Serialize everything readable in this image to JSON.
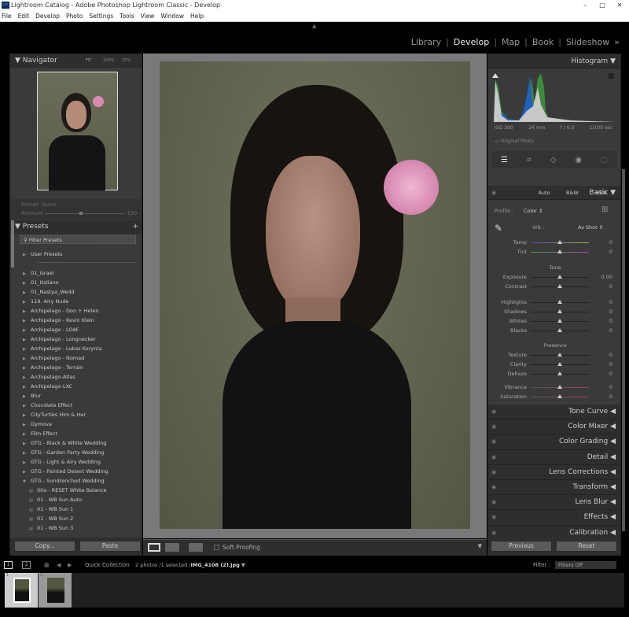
{
  "window": {
    "title": "Lightroom Catalog - Adobe Photoshop Lightroom Classic - Develop",
    "icon": "Lrc",
    "controls": [
      "–",
      "□",
      "✕"
    ]
  },
  "menu": [
    "File",
    "Edit",
    "Develop",
    "Photo",
    "Settings",
    "Tools",
    "View",
    "Window",
    "Help"
  ],
  "modules": [
    {
      "label": "Library",
      "active": false
    },
    {
      "label": "Develop",
      "active": true
    },
    {
      "label": "Map",
      "active": false
    },
    {
      "label": "Book",
      "active": false
    },
    {
      "label": "Slideshow",
      "active": false
    }
  ],
  "modules_more": "»",
  "navigator": {
    "title": "Navigator",
    "zoom_options": [
      "FIT",
      "100%",
      "25%"
    ]
  },
  "preset_amount": {
    "preset_label": "Preset",
    "preset_value": "None",
    "amount_label": "Amount",
    "amount_value": "100",
    "amount_fraction": 0.6
  },
  "presets": {
    "title": "Presets",
    "add": "+",
    "filter_placeholder": "Filter Presets",
    "user_presets": "User Presets",
    "items": [
      "01_Israel",
      "01_Italiano",
      "01_Nastya_Wedd",
      "119. Airy Nude",
      "Archipelago - Don + Helen",
      "Archipelago - Kevin Klein",
      "Archipelago - LOAF",
      "Archipelago - Longnecker",
      "Archipelago - Lukas Korynta",
      "Archipelago - Nomad",
      "Archipelago - Terrain",
      "Archipelago-Atlas",
      "Archipelago-LXC",
      "Blur",
      "Chocolate Effect",
      "CityTurtles Him & Her",
      "Dymova",
      "Film Effect",
      "GTG - Black & White Wedding",
      "GTG - Garden Party Wedding",
      "GTG - Light & Airy Wedding",
      "GTG - Painted Desert Wedding"
    ],
    "expanded": "GTG - Sundrenched Wedding",
    "children": [
      "00a - RESET White Balance",
      "01 - WB Sun  Auto",
      "01 - WB Sun 1",
      "01 - WB Sun 2",
      "01 - WB Sun 3"
    ]
  },
  "left_buttons": {
    "copy": "Copy...",
    "paste": "Paste"
  },
  "toolbar": {
    "soft_proofing": "Soft Proofing"
  },
  "histogram": {
    "title": "Histogram",
    "iso": "ISO 200",
    "focal": "24 mm",
    "aperture": "f / 6.3",
    "shutter": "1/100 sec",
    "original_photo": "Original Photo"
  },
  "basic": {
    "title": "Basic",
    "auto": "Auto",
    "bw": "B&W",
    "hdr": "HDR",
    "profile_label": "Profile :",
    "profile_value": "Color",
    "wb_label": "WB :",
    "wb_value": "As Shot",
    "tone_label": "Tone",
    "presence_label": "Presence",
    "sliders": [
      {
        "label": "Temp",
        "value": "0"
      },
      {
        "label": "Tint",
        "value": "0"
      },
      {
        "label": "Exposure",
        "value": "0.00"
      },
      {
        "label": "Contrast",
        "value": "0"
      },
      {
        "label": "Highlights",
        "value": "0"
      },
      {
        "label": "Shadows",
        "value": "0"
      },
      {
        "label": "Whites",
        "value": "0"
      },
      {
        "label": "Blacks",
        "value": "0"
      },
      {
        "label": "Texture",
        "value": "0"
      },
      {
        "label": "Clarity",
        "value": "0"
      },
      {
        "label": "Dehaze",
        "value": "0"
      },
      {
        "label": "Vibrance",
        "value": "0"
      },
      {
        "label": "Saturation",
        "value": "0"
      }
    ]
  },
  "panels": [
    "Tone Curve",
    "Color Mixer",
    "Color Grading",
    "Detail",
    "Lens Corrections",
    "Transform",
    "Lens Blur",
    "Effects",
    "Calibration"
  ],
  "right_buttons": {
    "previous": "Previous",
    "reset": "Reset"
  },
  "filmbar": {
    "view1": "1",
    "view2": "2",
    "source": "Quick Collection",
    "count": "2 photos /1 selected /",
    "filename": "IMG_4108 (2).jpg",
    "filter_label": "Filter :",
    "filter_value": "Filters Off"
  },
  "filmstrip": [
    {
      "index": "1",
      "selected": true
    },
    {
      "index": "2",
      "selected": false
    }
  ]
}
